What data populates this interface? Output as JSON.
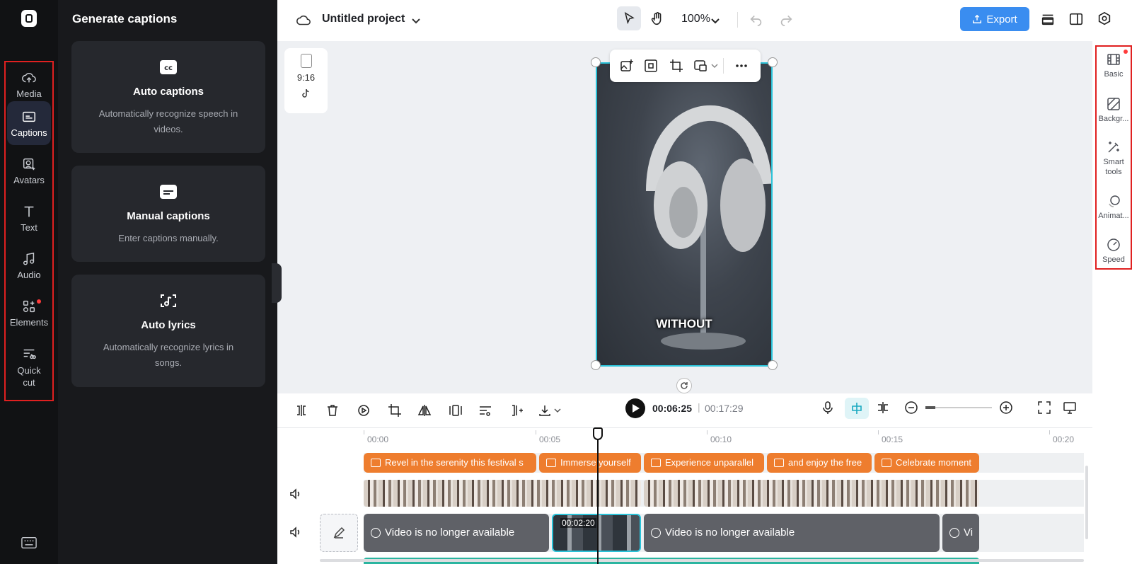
{
  "left_rail": {
    "items": [
      {
        "label": "Media",
        "icon": "cloud-upload-icon"
      },
      {
        "label": "Captions",
        "icon": "captions-icon",
        "active": true
      },
      {
        "label": "Avatars",
        "icon": "avatar-icon"
      },
      {
        "label": "Text",
        "icon": "text-icon"
      },
      {
        "label": "Audio",
        "icon": "music-note-icon"
      },
      {
        "label": "Elements",
        "icon": "elements-icon",
        "badge": true
      },
      {
        "label": "Quick cut",
        "icon": "quick-cut-icon"
      }
    ]
  },
  "panel": {
    "title": "Generate captions",
    "cards": [
      {
        "title": "Auto captions",
        "desc": "Automatically recognize speech in videos.",
        "icon": "cc-icon"
      },
      {
        "title": "Manual captions",
        "desc": "Enter captions manually.",
        "icon": "subtitle-icon"
      },
      {
        "title": "Auto lyrics",
        "desc": "Automatically recognize lyrics in songs.",
        "icon": "lyrics-scan-icon"
      }
    ]
  },
  "topbar": {
    "project_title": "Untitled project",
    "zoom": "100%",
    "export_label": "Export"
  },
  "preview": {
    "ratio": "9:16",
    "caption_word": "WITHOUT"
  },
  "right_rail": {
    "items": [
      {
        "label": "Basic",
        "icon": "film-icon",
        "badge": true
      },
      {
        "label": "Backgr...",
        "icon": "background-icon"
      },
      {
        "label": "Smart tools",
        "icon": "magic-wand-icon"
      },
      {
        "label": "Animat...",
        "icon": "animation-icon"
      },
      {
        "label": "Speed",
        "icon": "speedometer-icon"
      }
    ]
  },
  "playback": {
    "current_time": "00:06:25",
    "separator": "|",
    "total_time": "00:17:29"
  },
  "timeline": {
    "ruler": [
      "00:00",
      "00:05",
      "00:10",
      "00:15",
      "00:20"
    ],
    "captions": [
      "Revel in the serenity this festival s",
      "Immerse yourself",
      "Experience unparallel",
      "and enjoy the free",
      "Celebrate moment"
    ],
    "unavailable_label": "Video is no longer available",
    "unavailable_short": "Vi",
    "selected_clip_time": "00:02:20"
  },
  "colors": {
    "accent": "#3a8df0",
    "caption_clip": "#ee7d2e",
    "selection": "#2ac2d8",
    "highlight_box": "#e02020"
  }
}
